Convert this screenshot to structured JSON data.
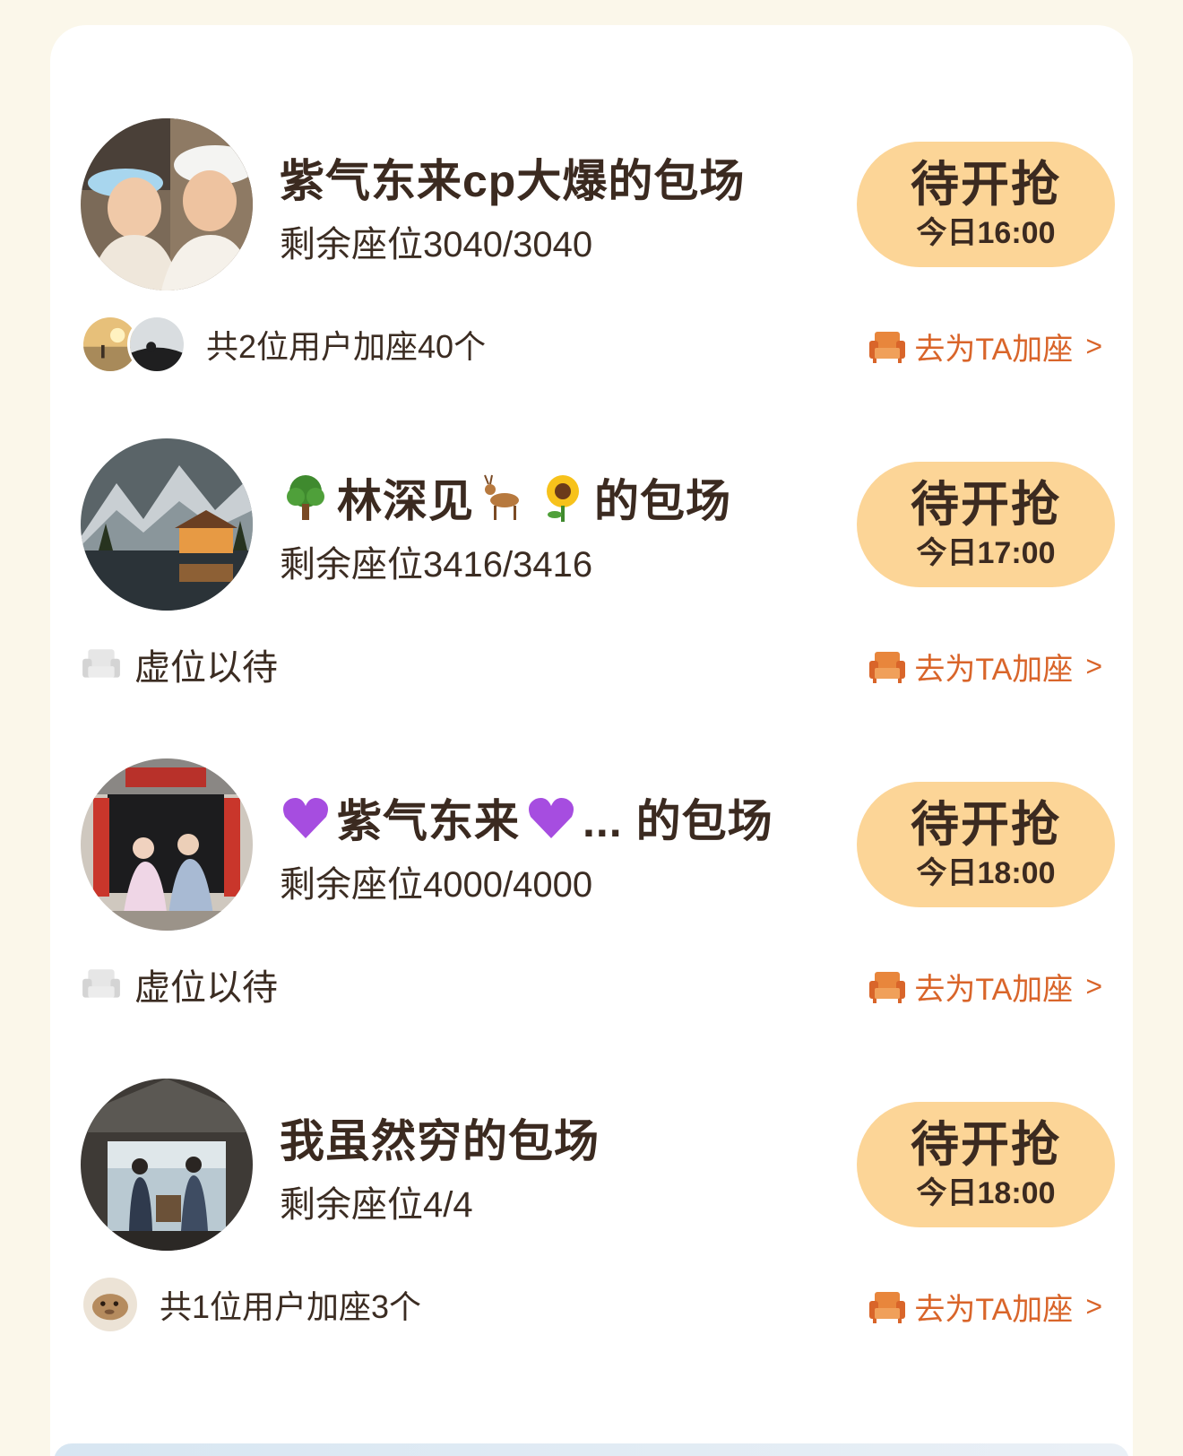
{
  "colors": {
    "page_bg": "#fbf7ea",
    "card_bg": "#ffffff",
    "status_button_bg": "#fcd597",
    "accent_orange": "#d9652a",
    "text_dark": "#3b2a20"
  },
  "entries": [
    {
      "title": "紫气东来cp大爆的包场",
      "title_parts": [],
      "seats": "剩余座位3040/3040",
      "status": {
        "label": "待开抢",
        "time": "今日16:00"
      },
      "footer": {
        "type": "users",
        "count_text": "共2位用户加座40个",
        "avatar_count": 2
      },
      "join_label": "去为TA加座",
      "join_chevron": ">"
    },
    {
      "title": "",
      "title_parts": [
        "林深见",
        "的包场"
      ],
      "title_emojis": [
        "tree-emoji",
        "deer-emoji",
        "sunflower-emoji"
      ],
      "seats": "剩余座位3416/3416",
      "status": {
        "label": "待开抢",
        "time": "今日17:00"
      },
      "footer": {
        "type": "empty",
        "empty_text": "虚位以待"
      },
      "join_label": "去为TA加座",
      "join_chevron": ">"
    },
    {
      "title": "",
      "title_parts": [
        "紫气东来",
        "... 的包场"
      ],
      "title_emojis": [
        "purple-heart-emoji",
        "purple-heart-emoji"
      ],
      "seats": "剩余座位4000/4000",
      "status": {
        "label": "待开抢",
        "time": "今日18:00"
      },
      "footer": {
        "type": "empty",
        "empty_text": "虚位以待"
      },
      "join_label": "去为TA加座",
      "join_chevron": ">"
    },
    {
      "title": "我虽然穷的包场",
      "title_parts": [],
      "seats": "剩余座位4/4",
      "status": {
        "label": "待开抢",
        "time": "今日18:00"
      },
      "footer": {
        "type": "users",
        "count_text": "共1位用户加座3个",
        "avatar_count": 1
      },
      "join_label": "去为TA加座",
      "join_chevron": ">"
    }
  ]
}
